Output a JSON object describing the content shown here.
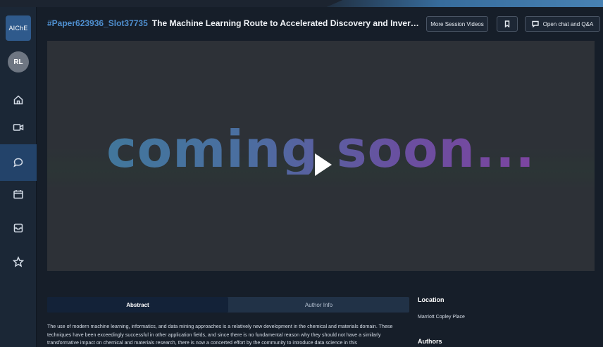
{
  "app": {
    "logo_text": "AIChE",
    "avatar_initials": "RL"
  },
  "sidebar": {
    "items": [
      {
        "name": "home",
        "icon": "home-icon",
        "active": false
      },
      {
        "name": "video",
        "icon": "video-camera-icon",
        "active": false
      },
      {
        "name": "chat",
        "icon": "chat-bubble-icon",
        "active": true
      },
      {
        "name": "calendar",
        "icon": "calendar-icon",
        "active": false
      },
      {
        "name": "archive",
        "icon": "archive-box-icon",
        "active": false
      },
      {
        "name": "favorites",
        "icon": "star-icon",
        "active": false
      }
    ]
  },
  "header": {
    "paper_id": "#Paper623936_Slot37735",
    "title": "The Machine Learning Route to Accelerated Discovery and Inverse Design of C...",
    "more_videos_label": "More Session Videos",
    "bookmark_icon": "bookmark-icon",
    "chat_label": "Open chat and Q&A",
    "chat_icon": "chat-bubble-icon"
  },
  "video": {
    "placeholder_text": "coming soon...",
    "play_icon": "play-icon"
  },
  "tabs": {
    "abstract_label": "Abstract",
    "author_info_label": "Author Info",
    "active": "abstract"
  },
  "abstract": {
    "text": "The use of modern machine learning, informatics, and data mining approaches is a relatively new development in the chemical and materials domain. These techniques have been exceedingly successful in other application fields, and since there is no fundamental reason why they should not have a similarly transformative impact on chemical and materials research, there is now a concerted effort by the community to introduce data science in this"
  },
  "details": {
    "location_heading": "Location",
    "location_value": "Marriott Copley Place",
    "authors_heading": "Authors"
  },
  "colors": {
    "accent": "#4f8fcf",
    "sidebar_active": "#23436a",
    "background": "#161e29"
  }
}
